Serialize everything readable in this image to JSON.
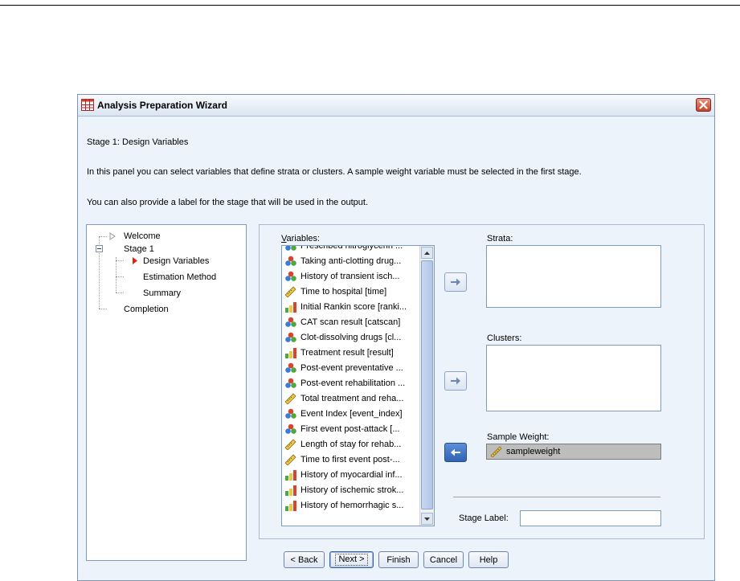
{
  "window": {
    "title": "Analysis Preparation Wizard"
  },
  "header": {
    "stage_title": "Stage 1: Design Variables",
    "description": "In this panel you can select variables that define strata or clusters. A sample weight variable must be selected in the first stage.",
    "label_note": "You can also provide a label for the stage that will be used in the output."
  },
  "tree": {
    "welcome": "Welcome",
    "stage1": "Stage 1",
    "design_variables": "Design Variables",
    "estimation_method": "Estimation Method",
    "summary": "Summary",
    "completion": "Completion"
  },
  "variables": {
    "label": "Variables:",
    "items": [
      {
        "text": "Prescribed nitroglycerin ...",
        "icon": "nominal-icon"
      },
      {
        "text": "Taking anti-clotting drug...",
        "icon": "nominal-icon"
      },
      {
        "text": "History of transient isch...",
        "icon": "nominal-icon"
      },
      {
        "text": "Time to hospital [time]",
        "icon": "scale-icon"
      },
      {
        "text": "Initial Rankin score [ranki...",
        "icon": "ordinal-icon"
      },
      {
        "text": "CAT scan result [catscan]",
        "icon": "nominal-icon"
      },
      {
        "text": "Clot-dissolving drugs [cl...",
        "icon": "nominal-icon"
      },
      {
        "text": "Treatment result [result]",
        "icon": "ordinal-icon"
      },
      {
        "text": "Post-event preventative ...",
        "icon": "nominal-icon"
      },
      {
        "text": "Post-event rehabilitation ...",
        "icon": "nominal-icon"
      },
      {
        "text": "Total treatment and reha...",
        "icon": "scale-icon"
      },
      {
        "text": "Event Index [event_index]",
        "icon": "nominal-icon"
      },
      {
        "text": "First event post-attack [...",
        "icon": "nominal-icon"
      },
      {
        "text": "Length of stay for rehab...",
        "icon": "scale-icon"
      },
      {
        "text": "Time to first event post-...",
        "icon": "scale-icon"
      },
      {
        "text": "History of myocardial inf...",
        "icon": "ordinal-icon"
      },
      {
        "text": "History of ischemic strok...",
        "icon": "ordinal-icon"
      },
      {
        "text": "History of hemorrhagic s...",
        "icon": "ordinal-icon"
      }
    ]
  },
  "strata": {
    "label": "Strata:"
  },
  "clusters": {
    "label": "Clusters:"
  },
  "sample_weight": {
    "label": "Sample Weight:",
    "value": "sampleweight"
  },
  "stage_label": {
    "label": "Stage Label:",
    "value": ""
  },
  "buttons": {
    "back": "< Back",
    "next": "Next >",
    "finish": "Finish",
    "cancel": "Cancel",
    "help": "Help"
  },
  "colors": {
    "accent": "#2f63b4",
    "dialog_bg": "#ecf3fb",
    "close": "#c6432d"
  }
}
